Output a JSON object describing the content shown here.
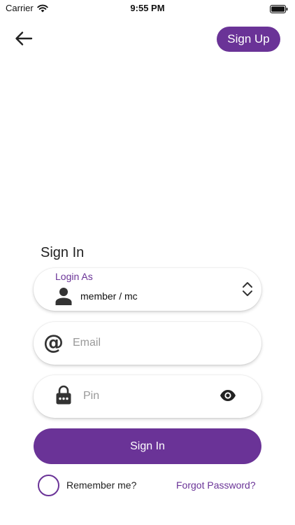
{
  "status_bar": {
    "carrier": "Carrier",
    "time": "9:55 PM"
  },
  "header": {
    "signup_label": "Sign Up"
  },
  "form": {
    "title": "Sign In",
    "login_as": {
      "label": "Login As",
      "value": "member / mc"
    },
    "email": {
      "value": "",
      "placeholder": "Email"
    },
    "pin": {
      "value": "",
      "placeholder": "Pin"
    },
    "signin_label": "Sign In",
    "remember_label": "Remember me?",
    "remember_checked": false,
    "forgot_label": "Forgot Password?"
  },
  "colors": {
    "accent": "#6a3397"
  },
  "icons": {
    "back": "arrow-left-icon",
    "signal": "wifi-icon",
    "battery": "battery-icon",
    "person": "person-icon",
    "selector": "chevron-up-down-icon",
    "email": "at-sign-icon",
    "lock": "lock-icon",
    "visibility": "eye-icon"
  }
}
